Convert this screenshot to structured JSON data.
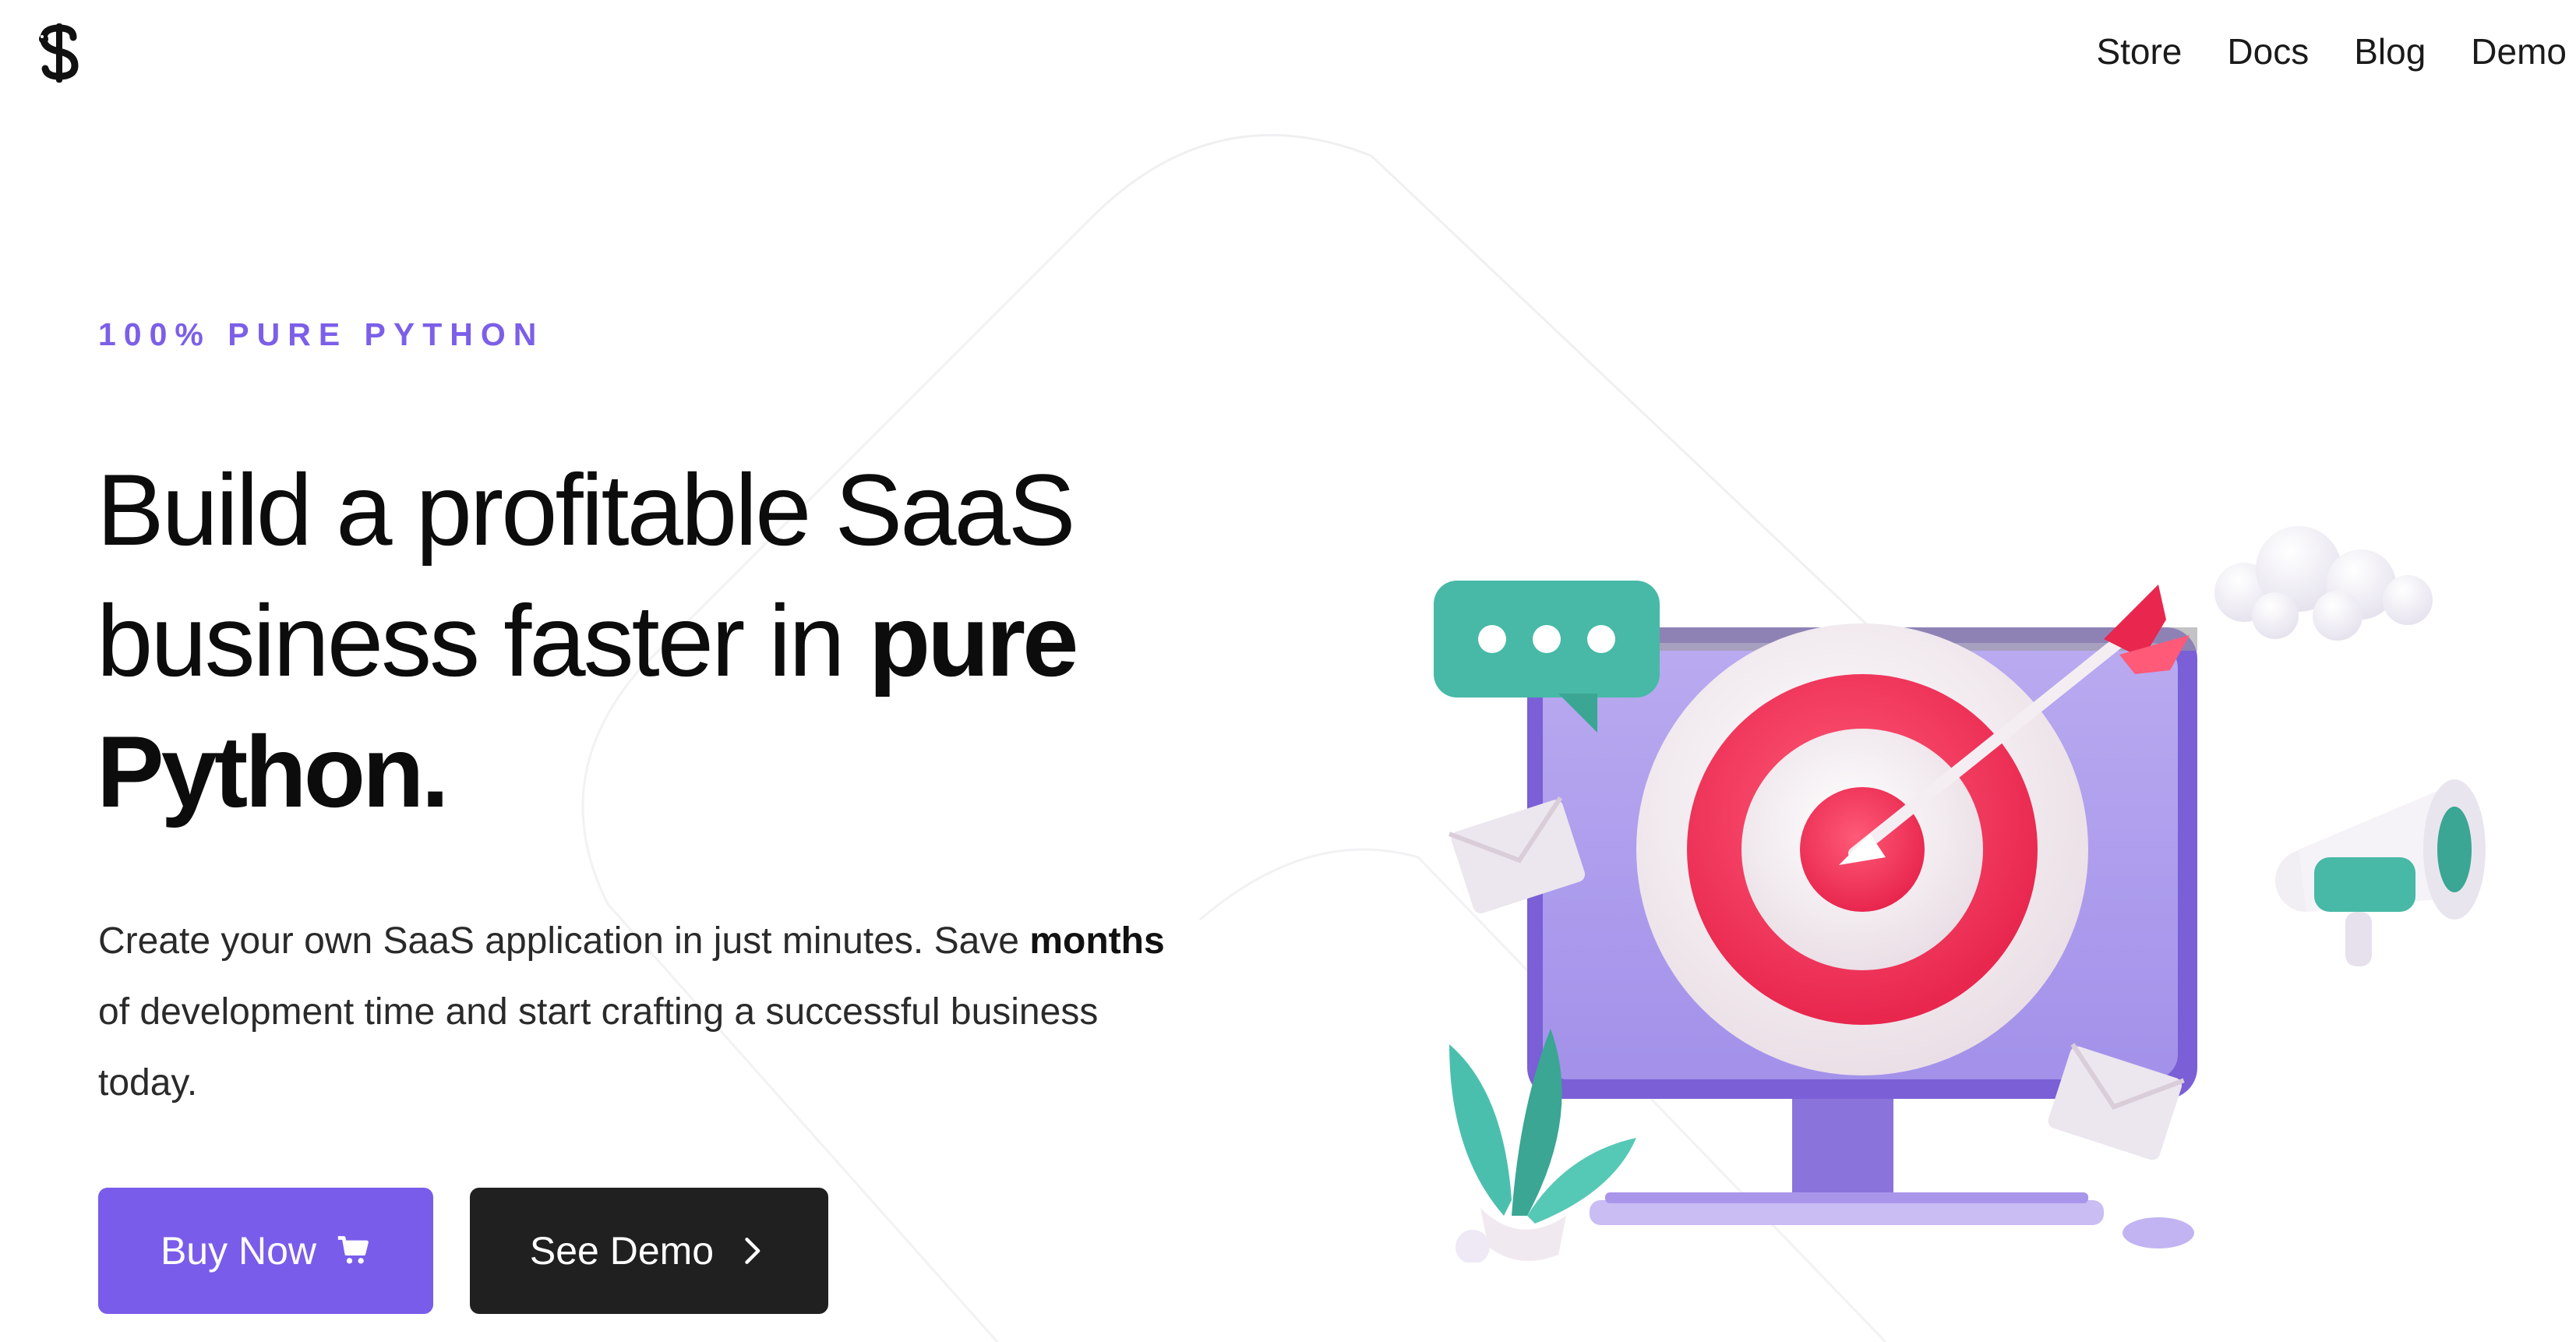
{
  "header": {
    "logo_icon": "dollar-snake-logo-icon",
    "nav": [
      {
        "label": "Store"
      },
      {
        "label": "Docs"
      },
      {
        "label": "Blog"
      },
      {
        "label": "Demo"
      }
    ]
  },
  "hero": {
    "eyebrow": "100% PURE PYTHON",
    "headline_regular_1": "Build a profitable SaaS",
    "headline_regular_2": "business faster in ",
    "headline_bold_1": "pure",
    "headline_bold_2": "Python.",
    "lead_part1": "Create your own SaaS application in just minutes. Save ",
    "lead_bold": "months",
    "lead_part2": " of development time and start crafting a successful business today.",
    "buttons": {
      "buy_label": "Buy Now",
      "buy_icon": "cart-icon",
      "demo_label": "See Demo",
      "demo_icon": "chevron-right-icon"
    }
  },
  "colors": {
    "accent": "#7a5ceb",
    "eyebrow": "#7c5fe8",
    "dark_button": "#202020",
    "text": "#0c0c0c"
  },
  "illustration": {
    "icon": "target-monitor-illustration"
  }
}
